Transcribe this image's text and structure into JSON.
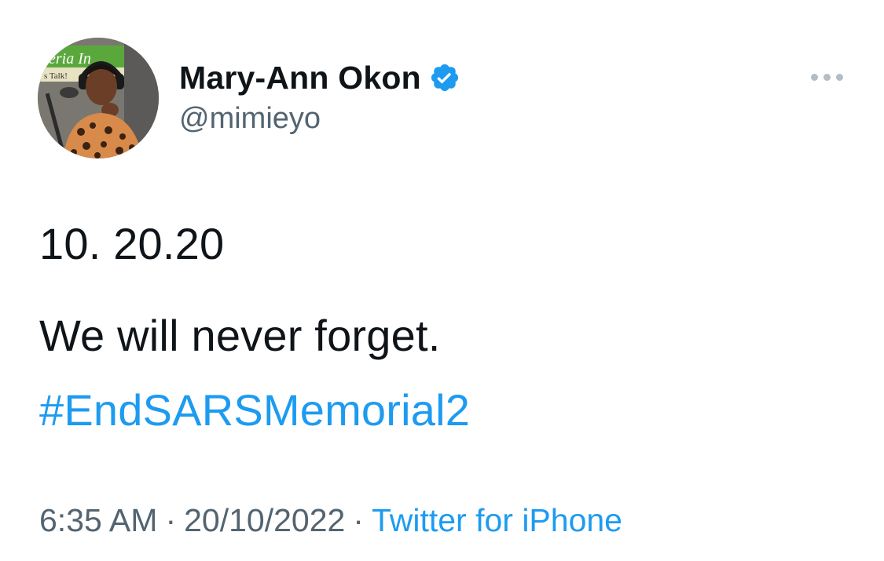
{
  "author": {
    "display_name": "Mary-Ann Okon",
    "handle": "@mimieyo",
    "verified_icon": "verified-badge-icon",
    "avatar_backdrop_text": "eria In",
    "avatar_backdrop_text_2": "s Talk!"
  },
  "menu": {
    "more_icon": "more-horizontal-icon"
  },
  "tweet": {
    "line1": "10. 20.20",
    "line2": "We will never forget.",
    "hashtag": "#EndSARSMemorial2"
  },
  "footer": {
    "time": "6:35 AM",
    "separator": "·",
    "date": "20/10/2022",
    "separator2": "·",
    "source": "Twitter for iPhone"
  },
  "colors": {
    "text": "#0f1419",
    "secondary": "#536471",
    "link": "#1d9bf0",
    "verified": "#1d9bf0",
    "background": "#ffffff"
  }
}
